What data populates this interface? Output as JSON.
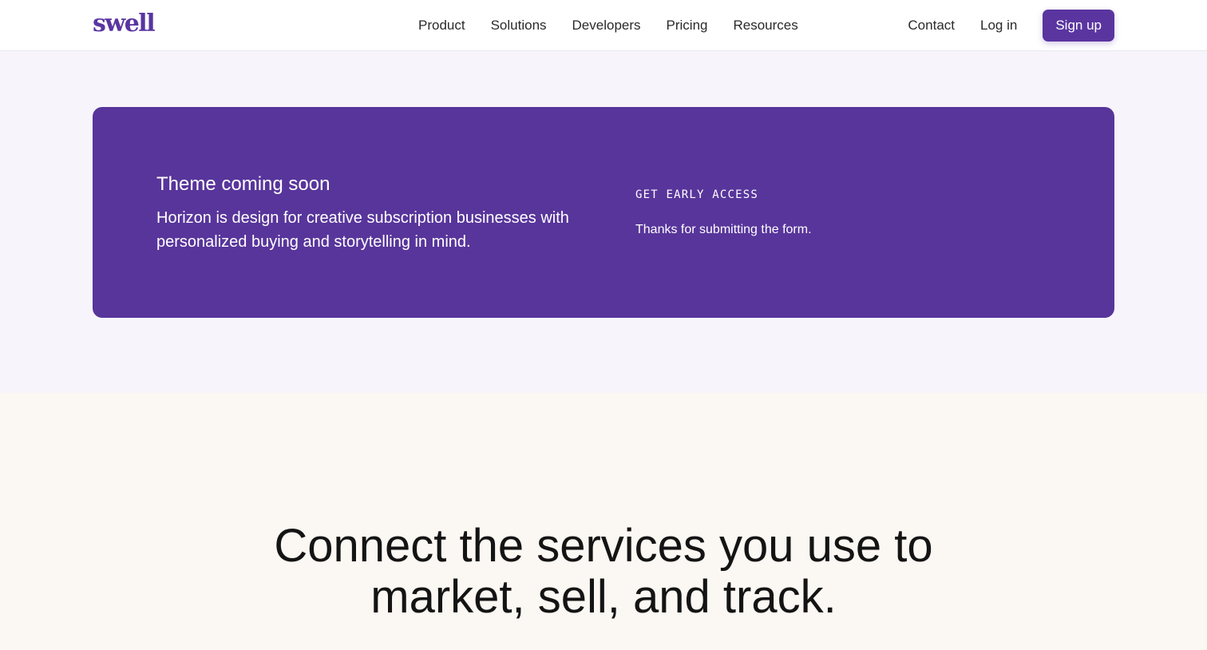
{
  "header": {
    "logo": "swell",
    "nav": [
      "Product",
      "Solutions",
      "Developers",
      "Pricing",
      "Resources"
    ],
    "contact": "Contact",
    "login": "Log in",
    "signup": "Sign up"
  },
  "theme_card": {
    "title": "Theme coming soon",
    "description": "Horizon is design for creative subscription businesses with personalized buying and storytelling in mind.",
    "eyebrow": "GET EARLY ACCESS",
    "confirmation": "Thanks for submitting the form."
  },
  "connect": {
    "heading_line1": "Connect the services you use to",
    "heading_line2": "market, sell, and track."
  },
  "colors": {
    "brand": "#5a35a0",
    "card": "#58359b",
    "page_bg": "#f7f5fb",
    "section_bg": "#fbf7f2"
  }
}
